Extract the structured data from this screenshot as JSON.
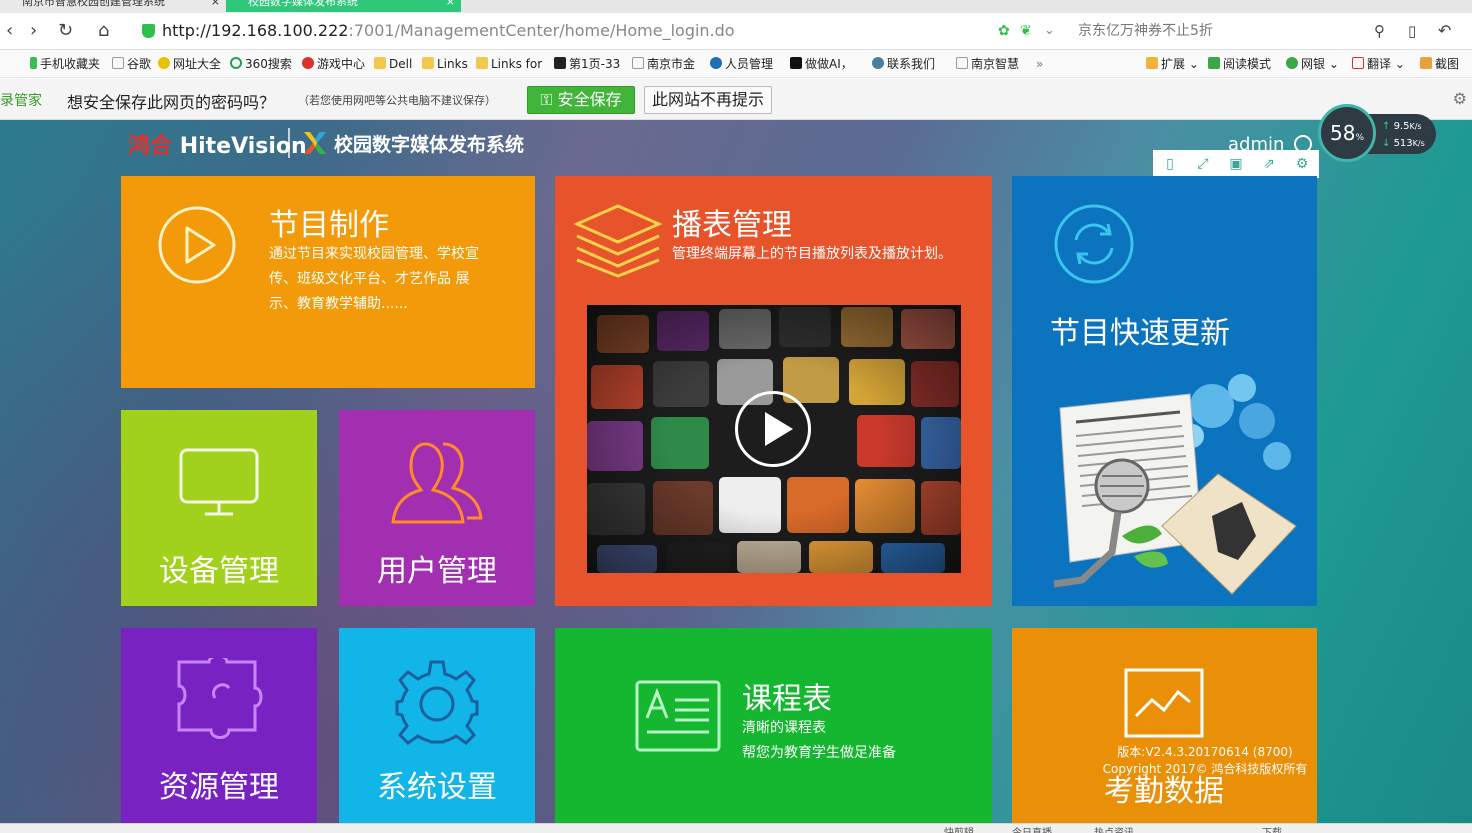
{
  "browser": {
    "tabs": [
      {
        "title": "南京市智慧校园创建管理系统"
      },
      {
        "title": "校园数字媒体发布系统"
      }
    ],
    "url_host": "http://192.168.100.222",
    "url_path": ":7001/ManagementCenter/home/Home_login.do",
    "search_placeholder": "京东亿万神券不止5折",
    "bookmarks": [
      "手机收藏夹",
      "谷歌",
      "网址大全",
      "360搜索",
      "游戏中心",
      "Dell",
      "Links",
      "Links for",
      "第1页-33",
      "南京市金",
      "人员管理",
      "做做AI，",
      "联系我们",
      "南京智慧"
    ],
    "toolbar_right": [
      "扩展",
      "阅读模式",
      "网银",
      "翻译",
      "截图"
    ]
  },
  "password_bar": {
    "brand": "录管家",
    "question": "想安全保存此网页的密码吗？",
    "note": "（若您使用网吧等公共电脑不建议保存）",
    "save_label": "安全保存",
    "dismiss_label": "此网站不再提示"
  },
  "header": {
    "logo_brand_cn": "鸿合",
    "logo_brand_en": "HiteVision",
    "system_name": "校园数字媒体发布系统",
    "user": "admin"
  },
  "tiles": {
    "program": {
      "title": "节目制作",
      "desc": "通过节目来实现校园管理、学校宣传、班级文化平台、才艺作品 展示、教育教学辅助......"
    },
    "playlist": {
      "title": "播表管理",
      "desc": "管理终端屏幕上的节目播放列表及播放计划。"
    },
    "quick": {
      "title": "节目快速更新"
    },
    "device": {
      "title": "设备管理"
    },
    "user": {
      "title": "用户管理"
    },
    "resource": {
      "title": "资源管理"
    },
    "settings": {
      "title": "系统设置"
    },
    "schedule": {
      "title": "课程表",
      "desc1": "清晰的课程表",
      "desc2": "帮您为教育学生做足准备"
    },
    "attend": {
      "title": "考勤数据"
    }
  },
  "version": {
    "line1": "版本:V2.4.3.20170614 (8700)",
    "line2": "Copyright 2017© 鸿合科技版权所有"
  },
  "net_widget": {
    "percent": "58",
    "up": "9.5",
    "down": "513",
    "unit": "K/s"
  },
  "statusbar": [
    "快剪辑",
    "今日直播",
    "热点资讯",
    "下载"
  ],
  "colors": {
    "program": "#f29a09",
    "playlist": "#e7532b",
    "quick": "#0c73bf",
    "device": "#a1d11d",
    "user": "#a12fb0",
    "resource": "#7922c2",
    "settings": "#11b5e8",
    "schedule": "#14b72f",
    "attend": "#ea8f08"
  }
}
